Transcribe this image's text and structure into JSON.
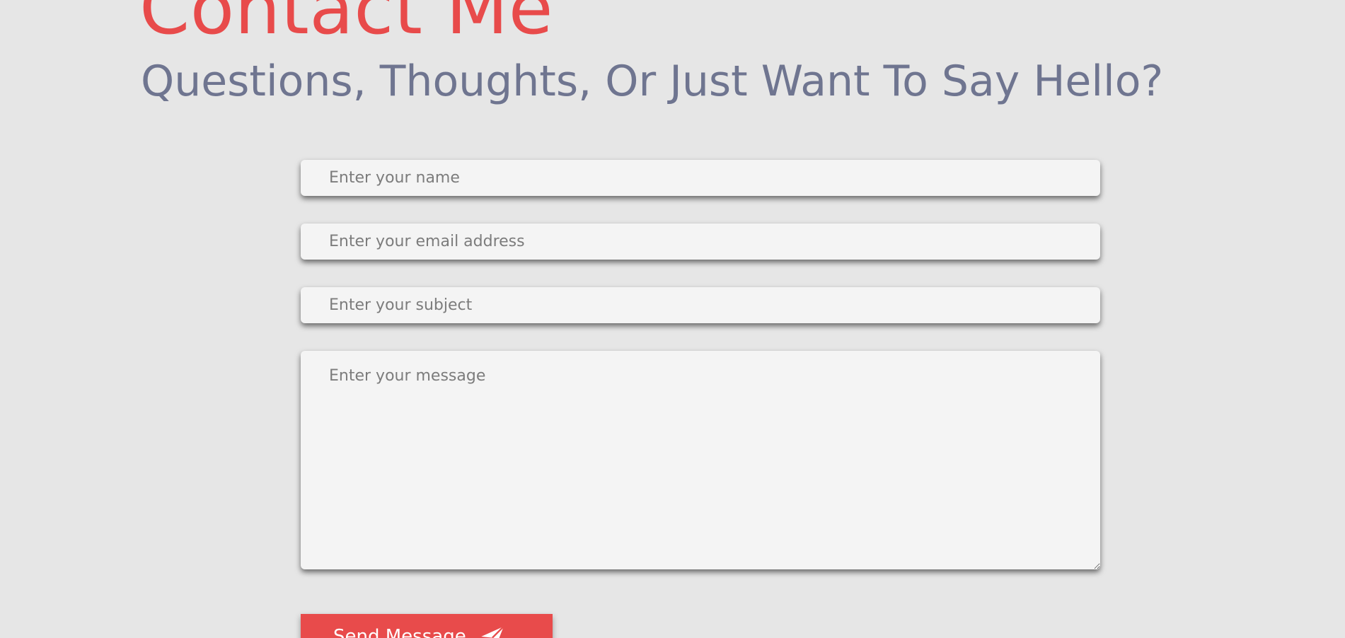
{
  "header": {
    "title": "Contact Me",
    "subtitle": "Questions, Thoughts, Or Just Want To Say Hello?"
  },
  "form": {
    "name_placeholder": "Enter your name",
    "email_placeholder": "Enter your email address",
    "subject_placeholder": "Enter your subject",
    "message_placeholder": "Enter your message",
    "submit_label": "Send Message",
    "submit_icon": "paper-plane-icon"
  },
  "colors": {
    "accent": "#e84b4b",
    "subtitle": "#6f7590",
    "background": "#e6e6e6",
    "field_background": "#f4f4f4"
  }
}
